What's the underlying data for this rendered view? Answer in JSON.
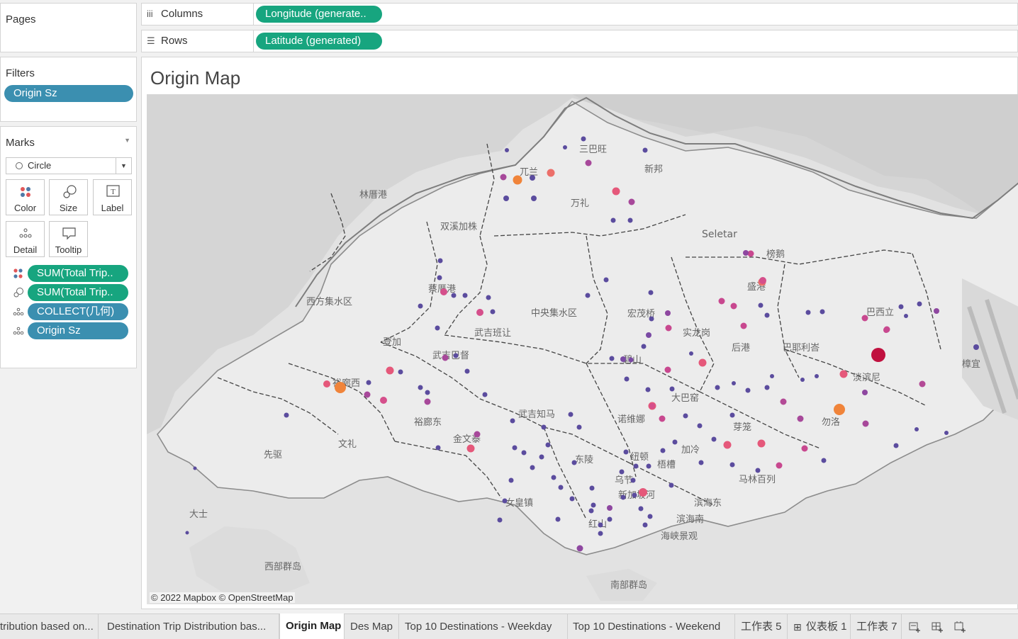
{
  "pages": {
    "title": "Pages"
  },
  "filters": {
    "title": "Filters",
    "pills": [
      "Origin Sz"
    ]
  },
  "marks": {
    "title": "Marks",
    "mark_type": "Circle",
    "buttons": [
      {
        "label": "Color",
        "icon": "color-dots-icon"
      },
      {
        "label": "Size",
        "icon": "size-icon"
      },
      {
        "label": "Label",
        "icon": "label-icon"
      },
      {
        "label": "Detail",
        "icon": "detail-dots-icon"
      },
      {
        "label": "Tooltip",
        "icon": "tooltip-icon"
      }
    ],
    "fields": [
      {
        "label": "SUM(Total Trip..",
        "icon": "color-dots-icon",
        "color": "#17a57f"
      },
      {
        "label": "SUM(Total Trip..",
        "icon": "size-icon",
        "color": "#17a57f"
      },
      {
        "label": "COLLECT(几何)",
        "icon": "detail-dots-icon",
        "color": "#3b8fb0"
      },
      {
        "label": "Origin Sz",
        "icon": "detail-dots-icon",
        "color": "#3b8fb0"
      }
    ]
  },
  "shelves": {
    "columns": {
      "label": "Columns",
      "pill": "Longitude (generate.."
    },
    "rows": {
      "label": "Rows",
      "pill": "Latitude (generated)"
    }
  },
  "sheet": {
    "title": "Origin Map",
    "attribution": "© 2022 Mapbox © OpenStreetMap",
    "place_labels": [
      "三巴旺",
      "兀兰",
      "新邦",
      "林厝港",
      "万礼",
      "双溪加株",
      "榜鹅",
      "Seletar",
      "盛港",
      "蔡厝港",
      "西方集水区",
      "中央集水区",
      "宏茂桥",
      "实龙岗",
      "后港",
      "巴耶利峇",
      "巴西立",
      "樟宜",
      "登加",
      "武吉班让",
      "武吉巴督",
      "碧山",
      "淡滨尼",
      "裕廊西",
      "裕廊东",
      "武吉知马",
      "诺维娜",
      "大巴窑",
      "芽笼",
      "勿洛",
      "先驱",
      "文礼",
      "金文泰",
      "东陵",
      "纽顿",
      "梧槽",
      "加冷",
      "乌节",
      "马林百列",
      "大士",
      "女皇镇",
      "新加坡河",
      "滨海东",
      "红山",
      "滨海南",
      "海峡景观",
      "西部群岛",
      "南部群岛"
    ]
  },
  "colors": {
    "green_pill": "#17a57f",
    "blue_pill": "#3b8fb0",
    "low": "#5b4c9e",
    "mid": "#c8488f",
    "high": "#f0843a",
    "max": "#c0113f"
  },
  "tabs": [
    {
      "label": "tribution based on...",
      "active": false
    },
    {
      "label": "Destination Trip Distribution bas...",
      "active": false
    },
    {
      "label": "Origin Map",
      "active": true
    },
    {
      "label": "Des Map",
      "active": false
    },
    {
      "label": "Top 10 Destinations - Weekday",
      "active": false
    },
    {
      "label": "Top 10 Destinations - Weekend",
      "active": false
    },
    {
      "label": "工作表 5",
      "active": false
    },
    {
      "label": "仪表板 1",
      "active": false
    },
    {
      "label": "工作表 7",
      "active": false
    }
  ]
}
